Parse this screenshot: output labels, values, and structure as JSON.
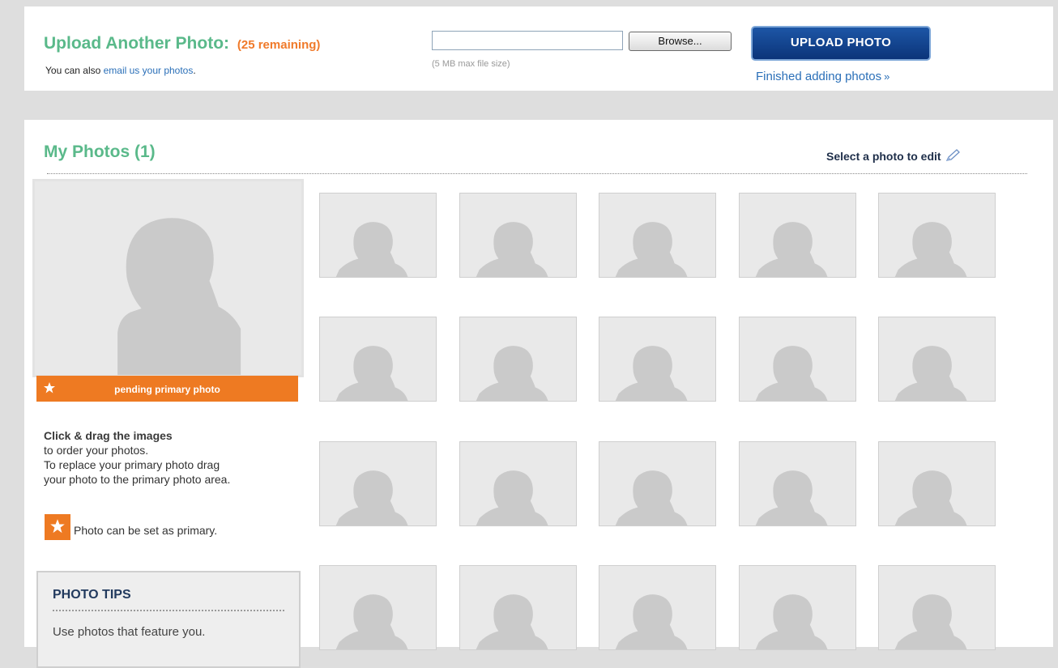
{
  "upload": {
    "title": "Upload Another Photo:",
    "remaining": "(25 remaining)",
    "sub_prefix": "You can also ",
    "email_link": "email us your photos",
    "sub_suffix": ".",
    "file_value": "",
    "browse_label": "Browse...",
    "max_size": "(5 MB max file size)",
    "upload_button": "UPLOAD PHOTO",
    "finished_link": "Finished adding photos",
    "finished_arrow": "»"
  },
  "photos": {
    "title": "My Photos (1)",
    "select_edit": "Select a photo to edit",
    "primary_label": "pending primary photo",
    "drag_heading": "Click & drag the images",
    "drag_line1": "to order your photos.",
    "drag_line2": "To replace your primary photo drag",
    "drag_line3": "your photo to the primary photo area.",
    "legend_text": "Photo can be set as primary.",
    "thumb_count": 20
  },
  "tips": {
    "title": "PHOTO TIPS",
    "tip1": "Use photos that feature you."
  },
  "colors": {
    "green_heading": "#5ab98a",
    "orange": "#ee7a22",
    "link_blue": "#2a6fb8",
    "upload_blue": "#0b3479"
  }
}
